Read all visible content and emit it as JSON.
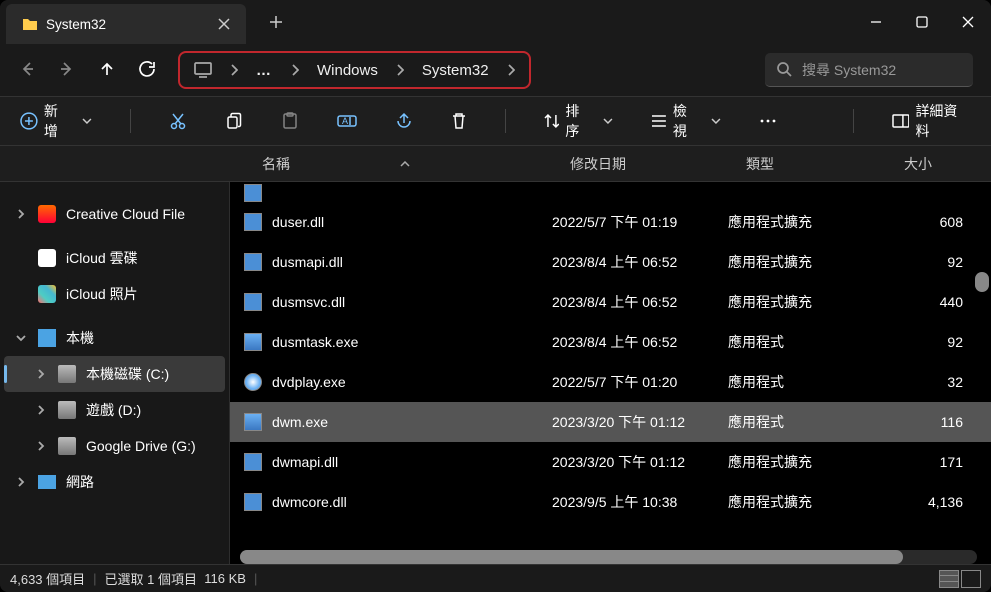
{
  "tab": {
    "title": "System32"
  },
  "breadcrumb": {
    "ellipsis": "…",
    "part1": "Windows",
    "part2": "System32"
  },
  "search": {
    "placeholder": "搜尋 System32"
  },
  "toolbar": {
    "new": "新增",
    "sort": "排序",
    "view": "檢視",
    "details": "詳細資料"
  },
  "columns": {
    "name": "名稱",
    "date": "修改日期",
    "type": "類型",
    "size": "大小"
  },
  "sidebar": {
    "items": [
      {
        "label": "Creative Cloud File",
        "icon": "cloud",
        "expandable": true
      },
      {
        "label": "iCloud 雲碟",
        "icon": "icloud"
      },
      {
        "label": "iCloud 照片",
        "icon": "photos"
      },
      {
        "label": "本機",
        "icon": "pc",
        "expandable": true,
        "expanded": true
      },
      {
        "label": "本機磁碟 (C:)",
        "icon": "drive",
        "indent": true,
        "selected": true,
        "expandable": true
      },
      {
        "label": "遊戲 (D:)",
        "icon": "drive",
        "indent": true,
        "expandable": true
      },
      {
        "label": "Google Drive (G:)",
        "icon": "drive",
        "indent": true,
        "expandable": true
      },
      {
        "label": "網路",
        "icon": "net",
        "expandable": true
      }
    ]
  },
  "files": [
    {
      "name": "duser.dll",
      "date": "2022/5/7 下午 01:19",
      "type": "應用程式擴充",
      "size": "608",
      "icon": "dll"
    },
    {
      "name": "dusmapi.dll",
      "date": "2023/8/4 上午 06:52",
      "type": "應用程式擴充",
      "size": "92",
      "icon": "dll"
    },
    {
      "name": "dusmsvc.dll",
      "date": "2023/8/4 上午 06:52",
      "type": "應用程式擴充",
      "size": "440",
      "icon": "dll"
    },
    {
      "name": "dusmtask.exe",
      "date": "2023/8/4 上午 06:52",
      "type": "應用程式",
      "size": "92",
      "icon": "app"
    },
    {
      "name": "dvdplay.exe",
      "date": "2022/5/7 下午 01:20",
      "type": "應用程式",
      "size": "32",
      "icon": "dvd"
    },
    {
      "name": "dwm.exe",
      "date": "2023/3/20 下午 01:12",
      "type": "應用程式",
      "size": "116",
      "icon": "app",
      "selected": true
    },
    {
      "name": "dwmapi.dll",
      "date": "2023/3/20 下午 01:12",
      "type": "應用程式擴充",
      "size": "171",
      "icon": "dll"
    },
    {
      "name": "dwmcore.dll",
      "date": "2023/9/5 上午 10:38",
      "type": "應用程式擴充",
      "size": "4,136",
      "icon": "dll"
    }
  ],
  "status": {
    "count": "4,633 個項目",
    "selection": "已選取 1 個項目",
    "selsize": "116 KB"
  }
}
